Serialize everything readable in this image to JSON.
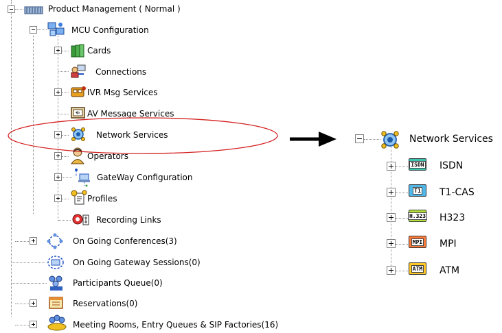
{
  "left_tree": {
    "root": {
      "label": "Product Management  ( Normal )",
      "icon": "server-icon",
      "state": "expanded"
    },
    "mcu": {
      "label": "MCU Configuration",
      "icon": "mcu-config-icon",
      "state": "expanded"
    },
    "mcu_children": [
      {
        "label": "Cards",
        "icon": "cards-icon",
        "state": "collapsed"
      },
      {
        "label": "Connections",
        "icon": "connections-icon",
        "state": "leaf"
      },
      {
        "label": "IVR Msg Services",
        "icon": "ivr-icon",
        "state": "collapsed"
      },
      {
        "label": "AV Message Services",
        "icon": "av-message-icon",
        "state": "leaf"
      },
      {
        "label": "Network Services",
        "icon": "network-services-icon",
        "state": "collapsed",
        "highlighted": true
      },
      {
        "label": "Operators",
        "icon": "operators-icon",
        "state": "collapsed"
      },
      {
        "label": "GateWay Configuration",
        "icon": "gateway-icon",
        "state": "collapsed"
      },
      {
        "label": "Profiles",
        "icon": "profiles-icon",
        "state": "collapsed"
      },
      {
        "label": "Recording Links",
        "icon": "recording-links-icon",
        "state": "leaf"
      }
    ],
    "top_level": [
      {
        "label": "On Going Conferences(3)",
        "icon": "conferences-icon",
        "state": "collapsed"
      },
      {
        "label": "On Going Gateway Sessions(0)",
        "icon": "gateway-sessions-icon",
        "state": "leaf"
      },
      {
        "label": "Participants Queue(0)",
        "icon": "participants-queue-icon",
        "state": "leaf"
      },
      {
        "label": "Reservations(0)",
        "icon": "reservations-icon",
        "state": "collapsed"
      },
      {
        "label": "Meeting Rooms, Entry Queues & SIP Factories(16)",
        "icon": "meeting-rooms-icon",
        "state": "collapsed"
      }
    ]
  },
  "highlight_color": "#d42020",
  "arrow_icon": "right-arrow-icon",
  "right_tree": {
    "parent": {
      "label": "Network Services",
      "icon": "network-services-icon",
      "state": "expanded"
    },
    "children": [
      {
        "label": "ISDN",
        "badge": "ISDN",
        "color": "#37c6b0",
        "state": "collapsed"
      },
      {
        "label": "T1-CAS",
        "badge": "T1",
        "color": "#4fb8e8",
        "state": "collapsed"
      },
      {
        "label": "H323",
        "badge": "H.323",
        "color": "#b4e03c",
        "state": "collapsed"
      },
      {
        "label": "MPI",
        "badge": "MPI",
        "color": "#ff7b3a",
        "state": "collapsed"
      },
      {
        "label": "ATM",
        "badge": "ATM",
        "color": "#ffc824",
        "state": "collapsed"
      }
    ]
  }
}
